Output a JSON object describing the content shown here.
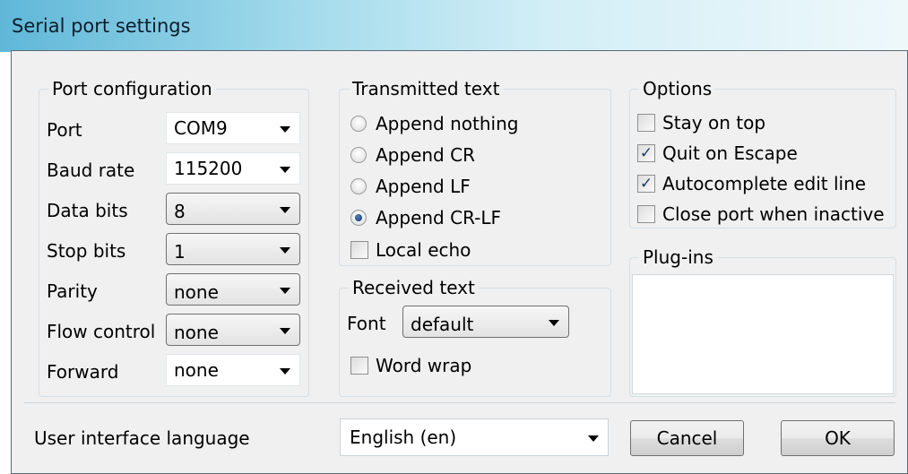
{
  "window": {
    "title": "Serial port settings"
  },
  "port_config": {
    "legend": "Port configuration",
    "port": {
      "label": "Port",
      "value": "COM9"
    },
    "baud": {
      "label": "Baud rate",
      "value": "115200"
    },
    "data_bits": {
      "label": "Data bits",
      "value": "8"
    },
    "stop_bits": {
      "label": "Stop bits",
      "value": "1"
    },
    "parity": {
      "label": "Parity",
      "value": "none"
    },
    "flow": {
      "label": "Flow control",
      "value": "none"
    },
    "forward": {
      "label": "Forward",
      "value": "none"
    }
  },
  "transmitted": {
    "legend": "Transmitted text",
    "options": [
      "Append nothing",
      "Append CR",
      "Append LF",
      "Append CR-LF"
    ],
    "selected": "Append CR-LF",
    "local_echo": {
      "label": "Local echo",
      "checked": false
    }
  },
  "received": {
    "legend": "Received text",
    "font_label": "Font",
    "font_value": "default",
    "word_wrap": {
      "label": "Word wrap",
      "checked": false
    }
  },
  "options": {
    "legend": "Options",
    "items": [
      {
        "label": "Stay on top",
        "checked": false
      },
      {
        "label": "Quit on Escape",
        "checked": true
      },
      {
        "label": "Autocomplete edit line",
        "checked": true
      },
      {
        "label": "Close port when inactive",
        "checked": false
      }
    ]
  },
  "plugins": {
    "legend": "Plug-ins"
  },
  "footer": {
    "language_label": "User interface language",
    "language_value": "English (en)",
    "cancel_label": "Cancel",
    "ok_label": "OK"
  }
}
